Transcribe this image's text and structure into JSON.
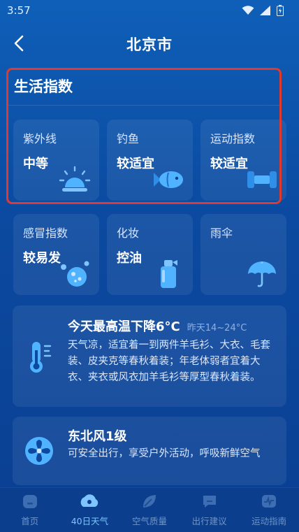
{
  "status": {
    "time": "3:57"
  },
  "header": {
    "title": "北京市"
  },
  "section": {
    "title": "生活指数"
  },
  "indices": [
    {
      "name": "紫外线",
      "value": "中等",
      "icon": "sun-icon"
    },
    {
      "name": "钓鱼",
      "value": "较适宜",
      "icon": "fish-icon"
    },
    {
      "name": "运动指数",
      "value": "较适宜",
      "icon": "dumbbell-icon"
    },
    {
      "name": "感冒指数",
      "value": "较易发",
      "icon": "virus-icon"
    },
    {
      "name": "化妆",
      "value": "控油",
      "icon": "spray-bottle-icon"
    },
    {
      "name": "雨伞",
      "value": "",
      "icon": "umbrella-icon"
    }
  ],
  "temperature_tip": {
    "headline": "今天最高温下降6°C",
    "range": "昨天14~24°C",
    "body": "天气凉，适宜着一到两件羊毛衫、大衣、毛套装、皮夹克等春秋着装；年老体弱者宜着大衣、夹衣或风衣加羊毛衫等厚型春秋着装。",
    "icon": "thermometer-icon"
  },
  "wind_tip": {
    "headline": "东北风1级",
    "body": "可安全出行，享受户外活动，呼吸新鲜空气",
    "icon": "fan-icon"
  },
  "nav": {
    "items": [
      {
        "label": "首页",
        "icon": "home-icon"
      },
      {
        "label": "40日天气",
        "icon": "weather-icon"
      },
      {
        "label": "空气质量",
        "icon": "leaf-icon"
      },
      {
        "label": "出行建议",
        "icon": "chat-icon"
      },
      {
        "label": "运动指南",
        "icon": "pulse-icon"
      }
    ],
    "active_index": 1
  },
  "colors": {
    "highlight": "#e03a2f",
    "accent": "#4fb3ff"
  }
}
